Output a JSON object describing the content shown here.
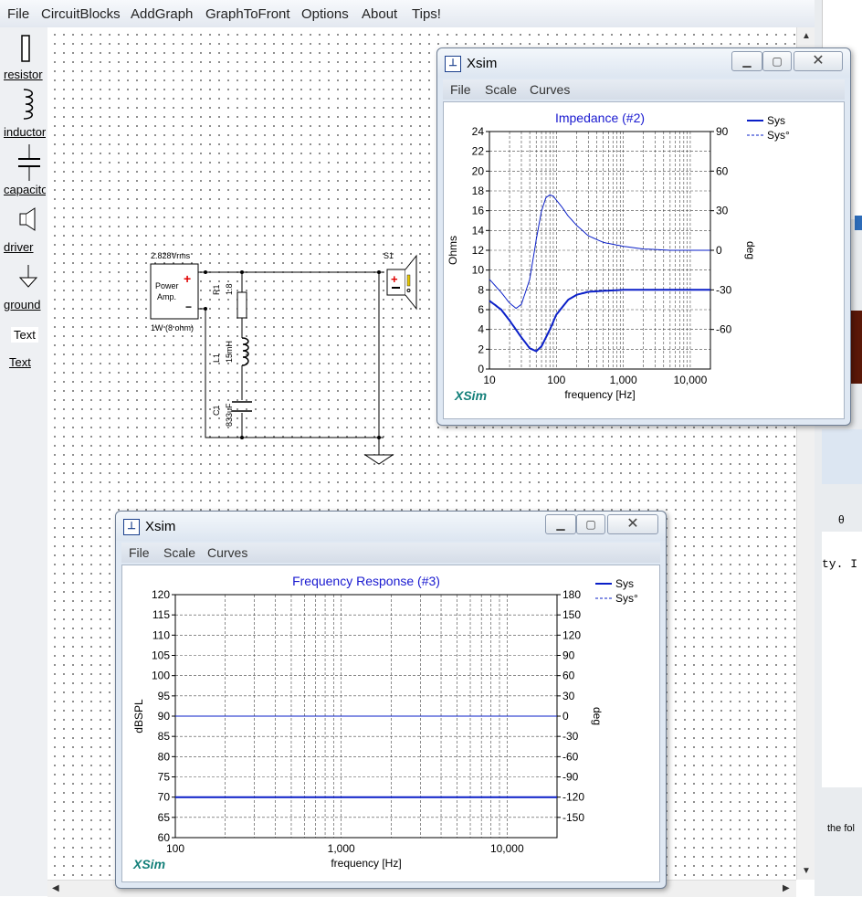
{
  "menubar": {
    "items": [
      "File",
      "CircuitBlocks",
      "AddGraph",
      "GraphToFront",
      "Options",
      "About",
      "Tips!"
    ]
  },
  "palette": {
    "items": [
      {
        "label": "resistor",
        "icon": "resistor-icon"
      },
      {
        "label": "inductor",
        "icon": "inductor-icon"
      },
      {
        "label": "capacitor",
        "icon": "capacitor-icon"
      },
      {
        "label": "driver",
        "icon": "speaker-icon"
      },
      {
        "label": "ground",
        "icon": "ground-icon"
      }
    ],
    "text_tool": "Text",
    "text_label": "Text"
  },
  "circuit": {
    "amp_voltage": "2.828Vrms",
    "amp_label1": "Power",
    "amp_label2": "Amp.",
    "amp_power": "1W (8 ohm)",
    "r1_name": "R1",
    "r1_value": "1.8",
    "l1_name": "L1",
    "l1_value": "15mH",
    "c1_name": "C1",
    "c1_value": "833uF",
    "speaker_name": "S1"
  },
  "window_impedance": {
    "title": "Xsim",
    "menu": [
      "File",
      "Scale",
      "Curves"
    ]
  },
  "window_freq": {
    "title": "Xsim",
    "menu": [
      "File",
      "Scale",
      "Curves"
    ]
  },
  "right_app": {
    "snippet1": "ty. I h",
    "snippet2": "the fol",
    "icon_theta": "θ"
  },
  "colors": {
    "curve": "#0a1fc8",
    "title_blue": "#1a1ad0",
    "xsim_logo": "#14807a"
  },
  "chart_data": [
    {
      "type": "line",
      "title": "Impedance (#2)",
      "xlabel": "frequency [Hz]",
      "ylabel": "Ohms",
      "y2label": "deg",
      "xscale": "log",
      "xlim": [
        10,
        20000
      ],
      "ylim": [
        0,
        24
      ],
      "y2lim": [
        -90,
        90
      ],
      "xticks": [
        "10",
        "100",
        "1,000",
        "10,000"
      ],
      "yticks": [
        "0",
        "2",
        "4",
        "6",
        "8",
        "10",
        "12",
        "14",
        "16",
        "18",
        "20",
        "22",
        "24"
      ],
      "y2ticks": [
        "-60",
        "-30",
        "0",
        "30",
        "60",
        "90"
      ],
      "logo": "XSim",
      "legend_position": "right",
      "series": [
        {
          "name": "Sys",
          "axis": "left",
          "style": "solid",
          "x": [
            10,
            15,
            20,
            30,
            40,
            50,
            60,
            80,
            100,
            150,
            200,
            300,
            500,
            1000,
            2000,
            5000,
            10000,
            20000
          ],
          "y": [
            6.9,
            6.0,
            4.9,
            3.2,
            2.1,
            1.8,
            2.3,
            4.0,
            5.5,
            7.0,
            7.5,
            7.8,
            7.9,
            8.0,
            8.0,
            8.0,
            8.0,
            8.0
          ]
        },
        {
          "name": "Sys°",
          "axis": "right",
          "style": "dashed",
          "x": [
            10,
            15,
            20,
            25,
            30,
            40,
            50,
            60,
            70,
            80,
            90,
            100,
            120,
            150,
            200,
            300,
            500,
            1000,
            2000,
            5000,
            10000,
            20000
          ],
          "y": [
            -22,
            -32,
            -40,
            -44,
            -41,
            -22,
            8,
            30,
            40,
            42,
            41,
            38,
            33,
            26,
            19,
            11,
            6,
            3,
            1,
            0,
            0,
            0
          ]
        }
      ]
    },
    {
      "type": "line",
      "title": "Frequency Response (#3)",
      "xlabel": "frequency [Hz]",
      "ylabel": "dBSPL",
      "y2label": "deg",
      "xscale": "log",
      "xlim": [
        100,
        20000
      ],
      "ylim": [
        60,
        120
      ],
      "y2lim": [
        -180,
        180
      ],
      "xticks": [
        "100",
        "1,000",
        "10,000"
      ],
      "yticks": [
        "60",
        "65",
        "70",
        "75",
        "80",
        "85",
        "90",
        "95",
        "100",
        "105",
        "110",
        "115",
        "120"
      ],
      "y2ticks": [
        "-150",
        "-120",
        "-90",
        "-60",
        "-30",
        "0",
        "30",
        "60",
        "90",
        "120",
        "150",
        "180"
      ],
      "logo": "XSim",
      "legend_position": "right",
      "series": [
        {
          "name": "Sys",
          "axis": "left",
          "style": "solid",
          "x": [
            100,
            20000
          ],
          "y": [
            70,
            70
          ]
        },
        {
          "name": "Sys°",
          "axis": "right",
          "style": "dashed",
          "x": [
            100,
            20000
          ],
          "y": [
            0,
            0
          ]
        }
      ]
    }
  ]
}
